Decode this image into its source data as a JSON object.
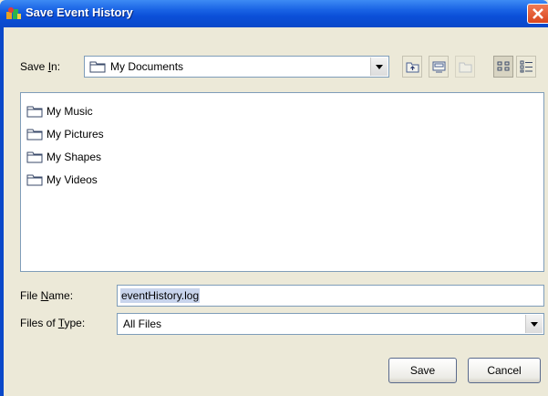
{
  "window": {
    "title": "Save Event History"
  },
  "save_in": {
    "label": "Save In:",
    "value": "My Documents"
  },
  "toolbar": {
    "icons": [
      "up-folder-icon",
      "desktop-icon",
      "new-folder-icon",
      "list-view-icon",
      "details-view-icon"
    ]
  },
  "files": [
    {
      "name": "My Music",
      "icon": "folder-icon"
    },
    {
      "name": "My Pictures",
      "icon": "folder-icon"
    },
    {
      "name": "My Shapes",
      "icon": "folder-icon"
    },
    {
      "name": "My Videos",
      "icon": "folder-icon"
    }
  ],
  "file_name": {
    "label": "File Name:",
    "value": "eventHistory.log"
  },
  "file_type": {
    "label": "Files of Type:",
    "value": "All Files"
  },
  "buttons": {
    "save": "Save",
    "cancel": "Cancel"
  }
}
